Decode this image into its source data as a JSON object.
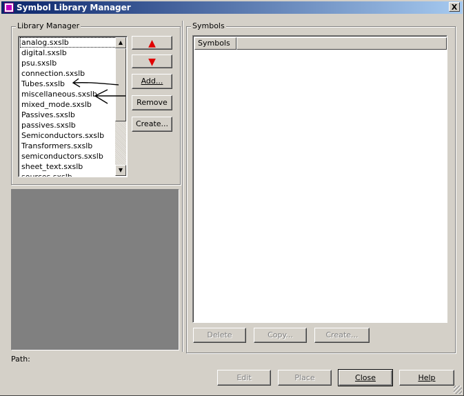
{
  "window": {
    "title": "Symbol Library Manager",
    "close_glyph": "X"
  },
  "library_manager": {
    "group_label": "Library Manager",
    "items": [
      "analog.sxslb",
      "digital.sxslb",
      "psu.sxslb",
      "connection.sxslb",
      "Tubes.sxslb",
      "miscellaneous.sxslb",
      "mixed_mode.sxslb",
      "Passives.sxslb",
      "passives.sxslb",
      "Semiconductors.sxslb",
      "Transformers.sxslb",
      "semiconductors.sxslb",
      "sheet_text.sxslb",
      "sources.sxslb"
    ],
    "move_up_glyph": "▲",
    "move_down_glyph": "▼",
    "add_label": "Add...",
    "remove_label": "Remove",
    "create_label": "Create..."
  },
  "symbols": {
    "group_label": "Symbols",
    "column_header": "Symbols",
    "delete_label": "Delete",
    "copy_label": "Copy...",
    "create_label": "Create..."
  },
  "path_label": "Path:",
  "footer": {
    "edit_label": "Edit",
    "place_label": "Place",
    "close_label": "Close",
    "help_label": "Help"
  },
  "colors": {
    "title_start": "#0a246a",
    "title_end": "#a6caf0",
    "face": "#d4d0c8",
    "preview": "#808080",
    "arrow": "#e00000"
  }
}
